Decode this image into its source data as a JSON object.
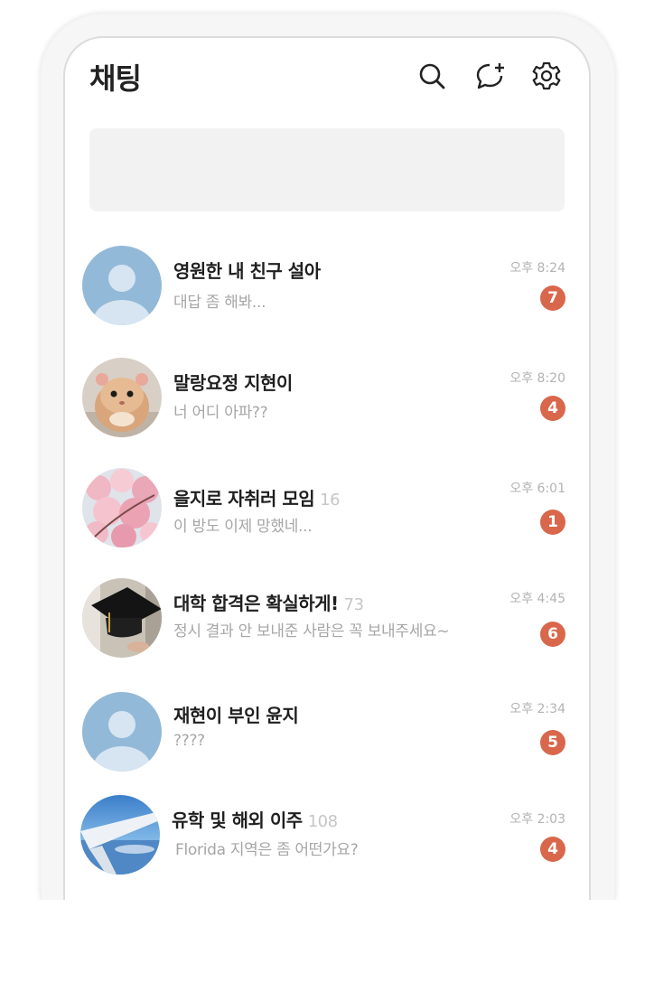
{
  "header": {
    "title": "채팅",
    "icons": [
      "search-icon",
      "new-chat-icon",
      "settings-icon"
    ]
  },
  "colors": {
    "badge": "#d9674b",
    "banner": "#f2f2f2",
    "time": "#b3b3b3"
  },
  "chats": [
    {
      "name": "영원한 내 친구 설아",
      "count": "",
      "preview": "대답 좀 해봐...",
      "time": "오후 8:24",
      "unread": "7",
      "avatar": "default-avatar"
    },
    {
      "name": "말랑요정 지현이",
      "count": "",
      "preview": "너 어디 아파??",
      "time": "오후 8:20",
      "unread": "4",
      "avatar": "hamster-photo"
    },
    {
      "name": "을지로 자취러 모임",
      "count": "16",
      "preview": "이 방도 이제 망했네...",
      "time": "오후 6:01",
      "unread": "1",
      "avatar": "cherry-blossom-photo"
    },
    {
      "name": "대학 합격은 확실하게!",
      "count": "73",
      "preview": "정시 결과 안 보내준 사람은 꼭 보내주세요~",
      "time": "오후 4:45",
      "unread": "6",
      "avatar": "graduation-cap-photo"
    },
    {
      "name": "재현이 부인 윤지",
      "count": "",
      "preview": "????",
      "time": "오후 2:34",
      "unread": "5",
      "avatar": "default-avatar"
    },
    {
      "name": "유학 및 해외 이주",
      "count": "108",
      "preview": "Florida 지역은 좀 어떤가요?",
      "time": "오후 2:03",
      "unread": "4",
      "avatar": "airplane-wing-photo"
    }
  ]
}
